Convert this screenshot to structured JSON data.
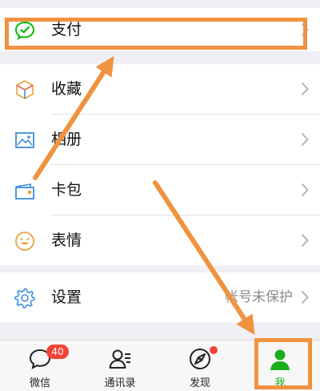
{
  "menu": {
    "pay": {
      "label": "支付",
      "icon": "wechat-pay-icon",
      "color": "#09bb07"
    },
    "favorites": {
      "label": "收藏",
      "icon": "cube-icon"
    },
    "album": {
      "label": "相册",
      "icon": "picture-icon"
    },
    "cards": {
      "label": "卡包",
      "icon": "card-icon"
    },
    "stickers": {
      "label": "表情",
      "icon": "smiley-icon"
    },
    "settings": {
      "label": "设置",
      "icon": "gear-icon",
      "status": "帐号未保护"
    }
  },
  "tabbar": {
    "tabs": [
      {
        "label": "微信",
        "icon": "chat-bubble-icon",
        "badge": "40"
      },
      {
        "label": "通讯录",
        "icon": "contacts-icon"
      },
      {
        "label": "发现",
        "icon": "compass-icon"
      },
      {
        "label": "我",
        "icon": "person-icon",
        "color": "#1aad19"
      }
    ]
  },
  "annotation": {
    "color": "#f0923f"
  }
}
